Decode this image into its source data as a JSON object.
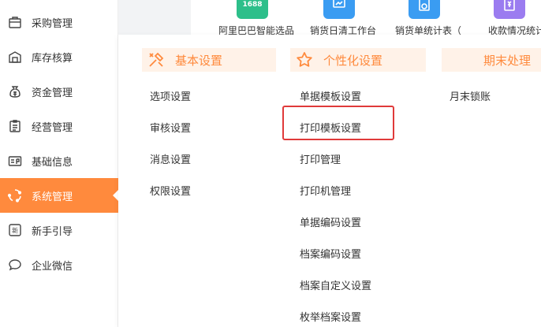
{
  "sidebar": {
    "items": [
      {
        "label": "采购管理",
        "icon": "purchase-bag-icon"
      },
      {
        "label": "库存核算",
        "icon": "warehouse-icon"
      },
      {
        "label": "资金管理",
        "icon": "money-bag-icon"
      },
      {
        "label": "经营管理",
        "icon": "clipboard-icon"
      },
      {
        "label": "基础信息",
        "icon": "id-card-icon"
      },
      {
        "label": "系统管理",
        "icon": "system-settings-icon"
      },
      {
        "label": "新手引导",
        "icon": "new-badge-icon"
      },
      {
        "label": "企业微信",
        "icon": "chat-bubble-icon"
      }
    ],
    "active_index": 5
  },
  "shortcuts": [
    {
      "label": "阿里巴巴智能选品",
      "icon": "1688-icon",
      "color": "#2dbf8a",
      "badge": "1688"
    },
    {
      "label": "销货日清工作台",
      "icon": "workbench-icon",
      "color": "#3a9cf2"
    },
    {
      "label": "销货单统计表（",
      "icon": "sales-report-icon",
      "color": "#3a9cf2"
    },
    {
      "label": "收款情况统计",
      "icon": "payment-stats-icon",
      "color": "#9b7cf0"
    }
  ],
  "panel": {
    "columns": [
      {
        "title": "基本设置",
        "icon": "wrench-pencil-icon",
        "items": [
          "选项设置",
          "审核设置",
          "消息设置",
          "权限设置"
        ]
      },
      {
        "title": "个性化设置",
        "icon": "star-icon",
        "items": [
          "单据模板设置",
          "打印模板设置",
          "打印管理",
          "打印机管理",
          "单据编码设置",
          "档案编码设置",
          "档案自定义设置",
          "枚举档案设置"
        ]
      },
      {
        "title": "期末处理",
        "icon": "",
        "items": [
          "月末锁账"
        ]
      }
    ],
    "highlighted_item": "打印模板设置"
  },
  "colors": {
    "accent": "#ff8a3d",
    "accent_light": "#fff2e8",
    "highlight_border": "#e03a3a"
  }
}
